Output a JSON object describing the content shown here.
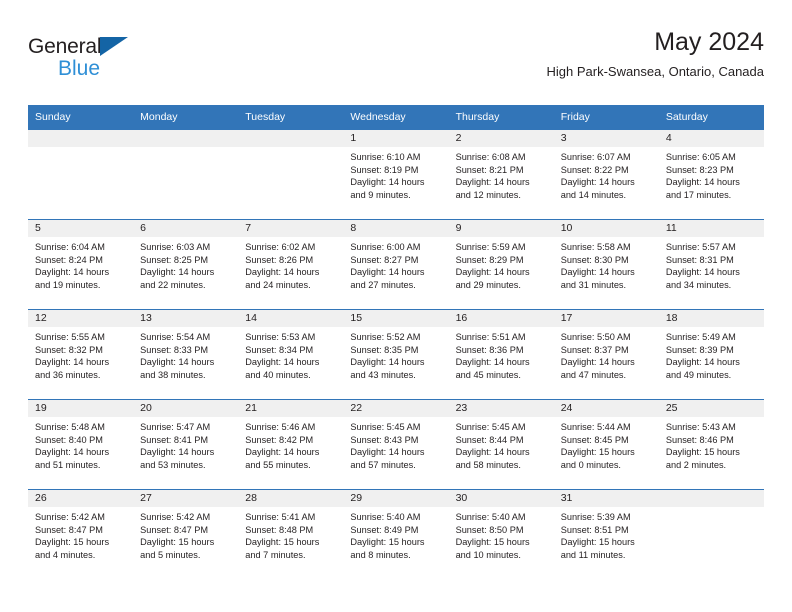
{
  "brand": {
    "name_part1": "General",
    "name_part2": "Blue",
    "triangle_icon": "triangle-icon",
    "accent_color": "#2f8fd6",
    "triangle_color": "#1464a5"
  },
  "header": {
    "title": "May 2024",
    "subtitle": "High Park-Swansea, Ontario, Canada"
  },
  "theme": {
    "header_row_bg": "#3275b8",
    "daynum_bg": "#f0f0f0",
    "text_color": "#231f20"
  },
  "weekday_headers": [
    "Sunday",
    "Monday",
    "Tuesday",
    "Wednesday",
    "Thursday",
    "Friday",
    "Saturday"
  ],
  "weeks": [
    [
      {
        "day": "",
        "sunrise": "",
        "sunset": "",
        "daylight_line1": "",
        "daylight_line2": "",
        "empty": true
      },
      {
        "day": "",
        "sunrise": "",
        "sunset": "",
        "daylight_line1": "",
        "daylight_line2": "",
        "empty": true
      },
      {
        "day": "",
        "sunrise": "",
        "sunset": "",
        "daylight_line1": "",
        "daylight_line2": "",
        "empty": true
      },
      {
        "day": "1",
        "sunrise": "Sunrise: 6:10 AM",
        "sunset": "Sunset: 8:19 PM",
        "daylight_line1": "Daylight: 14 hours",
        "daylight_line2": "and 9 minutes."
      },
      {
        "day": "2",
        "sunrise": "Sunrise: 6:08 AM",
        "sunset": "Sunset: 8:21 PM",
        "daylight_line1": "Daylight: 14 hours",
        "daylight_line2": "and 12 minutes."
      },
      {
        "day": "3",
        "sunrise": "Sunrise: 6:07 AM",
        "sunset": "Sunset: 8:22 PM",
        "daylight_line1": "Daylight: 14 hours",
        "daylight_line2": "and 14 minutes."
      },
      {
        "day": "4",
        "sunrise": "Sunrise: 6:05 AM",
        "sunset": "Sunset: 8:23 PM",
        "daylight_line1": "Daylight: 14 hours",
        "daylight_line2": "and 17 minutes."
      }
    ],
    [
      {
        "day": "5",
        "sunrise": "Sunrise: 6:04 AM",
        "sunset": "Sunset: 8:24 PM",
        "daylight_line1": "Daylight: 14 hours",
        "daylight_line2": "and 19 minutes."
      },
      {
        "day": "6",
        "sunrise": "Sunrise: 6:03 AM",
        "sunset": "Sunset: 8:25 PM",
        "daylight_line1": "Daylight: 14 hours",
        "daylight_line2": "and 22 minutes."
      },
      {
        "day": "7",
        "sunrise": "Sunrise: 6:02 AM",
        "sunset": "Sunset: 8:26 PM",
        "daylight_line1": "Daylight: 14 hours",
        "daylight_line2": "and 24 minutes."
      },
      {
        "day": "8",
        "sunrise": "Sunrise: 6:00 AM",
        "sunset": "Sunset: 8:27 PM",
        "daylight_line1": "Daylight: 14 hours",
        "daylight_line2": "and 27 minutes."
      },
      {
        "day": "9",
        "sunrise": "Sunrise: 5:59 AM",
        "sunset": "Sunset: 8:29 PM",
        "daylight_line1": "Daylight: 14 hours",
        "daylight_line2": "and 29 minutes."
      },
      {
        "day": "10",
        "sunrise": "Sunrise: 5:58 AM",
        "sunset": "Sunset: 8:30 PM",
        "daylight_line1": "Daylight: 14 hours",
        "daylight_line2": "and 31 minutes."
      },
      {
        "day": "11",
        "sunrise": "Sunrise: 5:57 AM",
        "sunset": "Sunset: 8:31 PM",
        "daylight_line1": "Daylight: 14 hours",
        "daylight_line2": "and 34 minutes."
      }
    ],
    [
      {
        "day": "12",
        "sunrise": "Sunrise: 5:55 AM",
        "sunset": "Sunset: 8:32 PM",
        "daylight_line1": "Daylight: 14 hours",
        "daylight_line2": "and 36 minutes."
      },
      {
        "day": "13",
        "sunrise": "Sunrise: 5:54 AM",
        "sunset": "Sunset: 8:33 PM",
        "daylight_line1": "Daylight: 14 hours",
        "daylight_line2": "and 38 minutes."
      },
      {
        "day": "14",
        "sunrise": "Sunrise: 5:53 AM",
        "sunset": "Sunset: 8:34 PM",
        "daylight_line1": "Daylight: 14 hours",
        "daylight_line2": "and 40 minutes."
      },
      {
        "day": "15",
        "sunrise": "Sunrise: 5:52 AM",
        "sunset": "Sunset: 8:35 PM",
        "daylight_line1": "Daylight: 14 hours",
        "daylight_line2": "and 43 minutes."
      },
      {
        "day": "16",
        "sunrise": "Sunrise: 5:51 AM",
        "sunset": "Sunset: 8:36 PM",
        "daylight_line1": "Daylight: 14 hours",
        "daylight_line2": "and 45 minutes."
      },
      {
        "day": "17",
        "sunrise": "Sunrise: 5:50 AM",
        "sunset": "Sunset: 8:37 PM",
        "daylight_line1": "Daylight: 14 hours",
        "daylight_line2": "and 47 minutes."
      },
      {
        "day": "18",
        "sunrise": "Sunrise: 5:49 AM",
        "sunset": "Sunset: 8:39 PM",
        "daylight_line1": "Daylight: 14 hours",
        "daylight_line2": "and 49 minutes."
      }
    ],
    [
      {
        "day": "19",
        "sunrise": "Sunrise: 5:48 AM",
        "sunset": "Sunset: 8:40 PM",
        "daylight_line1": "Daylight: 14 hours",
        "daylight_line2": "and 51 minutes."
      },
      {
        "day": "20",
        "sunrise": "Sunrise: 5:47 AM",
        "sunset": "Sunset: 8:41 PM",
        "daylight_line1": "Daylight: 14 hours",
        "daylight_line2": "and 53 minutes."
      },
      {
        "day": "21",
        "sunrise": "Sunrise: 5:46 AM",
        "sunset": "Sunset: 8:42 PM",
        "daylight_line1": "Daylight: 14 hours",
        "daylight_line2": "and 55 minutes."
      },
      {
        "day": "22",
        "sunrise": "Sunrise: 5:45 AM",
        "sunset": "Sunset: 8:43 PM",
        "daylight_line1": "Daylight: 14 hours",
        "daylight_line2": "and 57 minutes."
      },
      {
        "day": "23",
        "sunrise": "Sunrise: 5:45 AM",
        "sunset": "Sunset: 8:44 PM",
        "daylight_line1": "Daylight: 14 hours",
        "daylight_line2": "and 58 minutes."
      },
      {
        "day": "24",
        "sunrise": "Sunrise: 5:44 AM",
        "sunset": "Sunset: 8:45 PM",
        "daylight_line1": "Daylight: 15 hours",
        "daylight_line2": "and 0 minutes."
      },
      {
        "day": "25",
        "sunrise": "Sunrise: 5:43 AM",
        "sunset": "Sunset: 8:46 PM",
        "daylight_line1": "Daylight: 15 hours",
        "daylight_line2": "and 2 minutes."
      }
    ],
    [
      {
        "day": "26",
        "sunrise": "Sunrise: 5:42 AM",
        "sunset": "Sunset: 8:47 PM",
        "daylight_line1": "Daylight: 15 hours",
        "daylight_line2": "and 4 minutes."
      },
      {
        "day": "27",
        "sunrise": "Sunrise: 5:42 AM",
        "sunset": "Sunset: 8:47 PM",
        "daylight_line1": "Daylight: 15 hours",
        "daylight_line2": "and 5 minutes."
      },
      {
        "day": "28",
        "sunrise": "Sunrise: 5:41 AM",
        "sunset": "Sunset: 8:48 PM",
        "daylight_line1": "Daylight: 15 hours",
        "daylight_line2": "and 7 minutes."
      },
      {
        "day": "29",
        "sunrise": "Sunrise: 5:40 AM",
        "sunset": "Sunset: 8:49 PM",
        "daylight_line1": "Daylight: 15 hours",
        "daylight_line2": "and 8 minutes."
      },
      {
        "day": "30",
        "sunrise": "Sunrise: 5:40 AM",
        "sunset": "Sunset: 8:50 PM",
        "daylight_line1": "Daylight: 15 hours",
        "daylight_line2": "and 10 minutes."
      },
      {
        "day": "31",
        "sunrise": "Sunrise: 5:39 AM",
        "sunset": "Sunset: 8:51 PM",
        "daylight_line1": "Daylight: 15 hours",
        "daylight_line2": "and 11 minutes."
      },
      {
        "day": "",
        "sunrise": "",
        "sunset": "",
        "daylight_line1": "",
        "daylight_line2": "",
        "empty": true
      }
    ]
  ]
}
